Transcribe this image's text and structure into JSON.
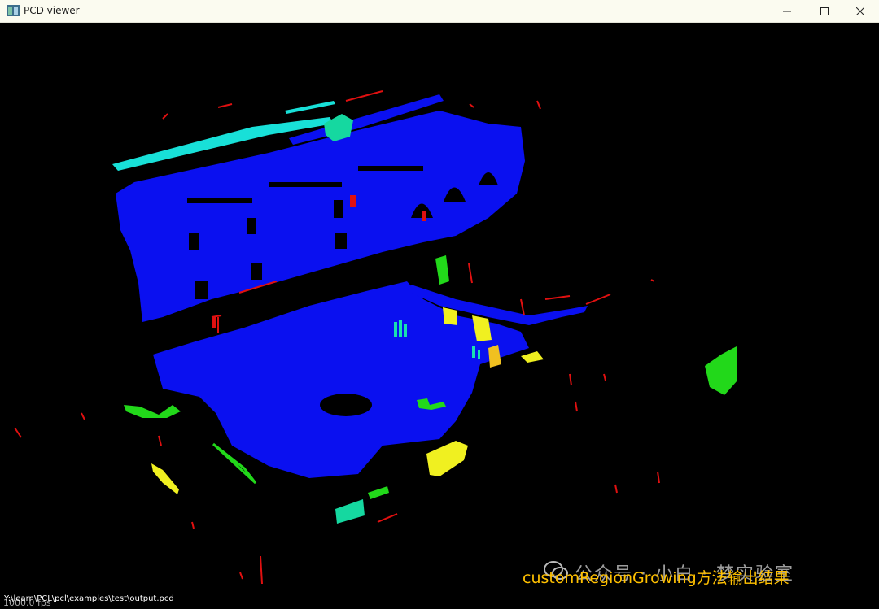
{
  "window": {
    "title": "PCD viewer",
    "controls": {
      "minimize": "minimize",
      "maximize": "maximize",
      "close": "close"
    }
  },
  "viewer": {
    "fps_text": "1000.0 fps",
    "file_path": "Y:\\learn\\PCL\\pcl\\examples\\test\\output.pcd",
    "caption": "customRegionGrowing方法输出结果",
    "watermark": "公众号 · 小白 · 梦实验室",
    "colors": {
      "background": "#000000",
      "blue": "#0a10f0",
      "red": "#e01010",
      "green": "#22d81a",
      "cyan": "#18e0d8",
      "yellow": "#f0f020",
      "aqua_green": "#15d8a0",
      "caption": "#ffc000"
    }
  }
}
